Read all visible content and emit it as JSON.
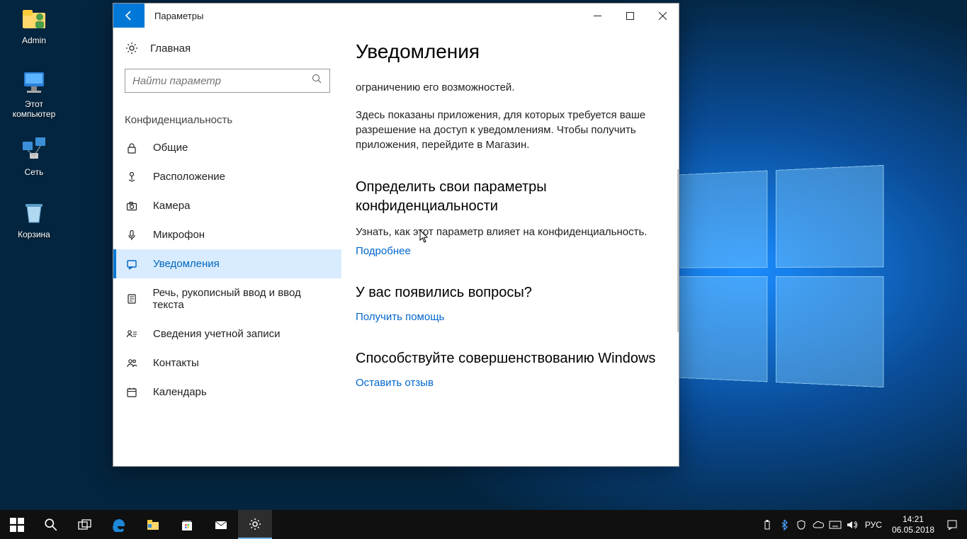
{
  "desktop": {
    "icons": [
      {
        "label": "Admin"
      },
      {
        "label": "Этот компьютер"
      },
      {
        "label": "Сеть"
      },
      {
        "label": "Корзина"
      }
    ]
  },
  "window": {
    "title": "Параметры",
    "sidebar": {
      "home": "Главная",
      "search_placeholder": "Найти параметр",
      "section": "Конфиденциальность",
      "items": [
        {
          "label": "Общие"
        },
        {
          "label": "Расположение"
        },
        {
          "label": "Камера"
        },
        {
          "label": "Микрофон"
        },
        {
          "label": "Уведомления"
        },
        {
          "label": "Речь, рукописный ввод и ввод текста"
        },
        {
          "label": "Сведения учетной записи"
        },
        {
          "label": "Контакты"
        },
        {
          "label": "Календарь"
        }
      ]
    },
    "content": {
      "heading": "Уведомления",
      "p1": "ограничению его возможностей.",
      "p2": "Здесь показаны приложения, для которых требуется ваше разрешение на доступ к уведомлениям. Чтобы получить приложения, перейдите в Магазин.",
      "h2a": "Определить свои параметры конфиденциальности",
      "desc_a": "Узнать, как этот параметр влияет на конфиденциальность.",
      "link_a": "Подробнее",
      "h2b": "У вас появились вопросы?",
      "link_b": "Получить помощь",
      "h2c": "Способствуйте совершенствованию Windows",
      "link_c": "Оставить отзыв"
    }
  },
  "taskbar": {
    "lang": "РУС",
    "time": "14:21",
    "date": "06.05.2018"
  }
}
